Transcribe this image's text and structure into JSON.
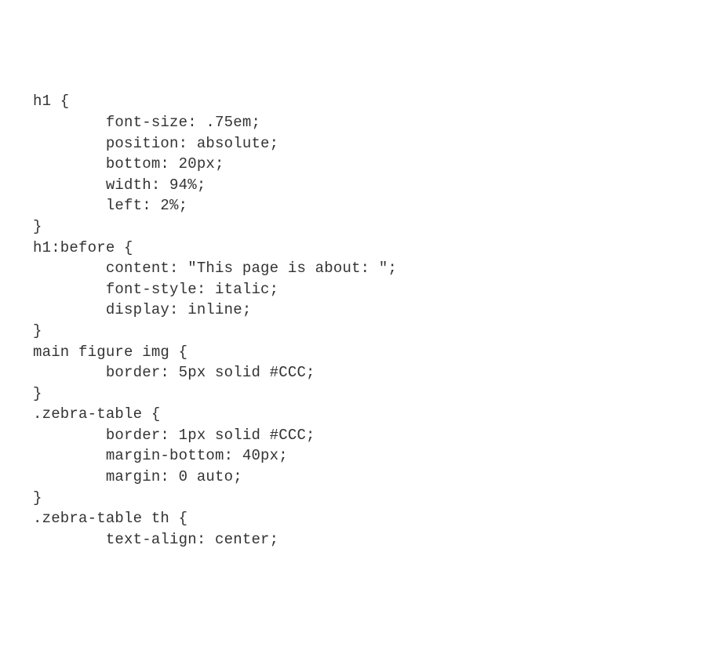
{
  "code": {
    "lines": [
      "h1 {",
      "        font-size: .75em;",
      "        position: absolute;",
      "        bottom: 20px;",
      "        width: 94%;",
      "        left: 2%;",
      "}",
      "",
      "h1:before {",
      "        content: \"This page is about: \";",
      "        font-style: italic;",
      "        display: inline;",
      "}",
      "",
      "main figure img {",
      "        border: 5px solid #CCC;",
      "}",
      "",
      ".zebra-table {",
      "        border: 1px solid #CCC;",
      "        margin-bottom: 40px;",
      "        margin: 0 auto;",
      "}",
      "",
      ".zebra-table th {",
      "        text-align: center;"
    ]
  }
}
